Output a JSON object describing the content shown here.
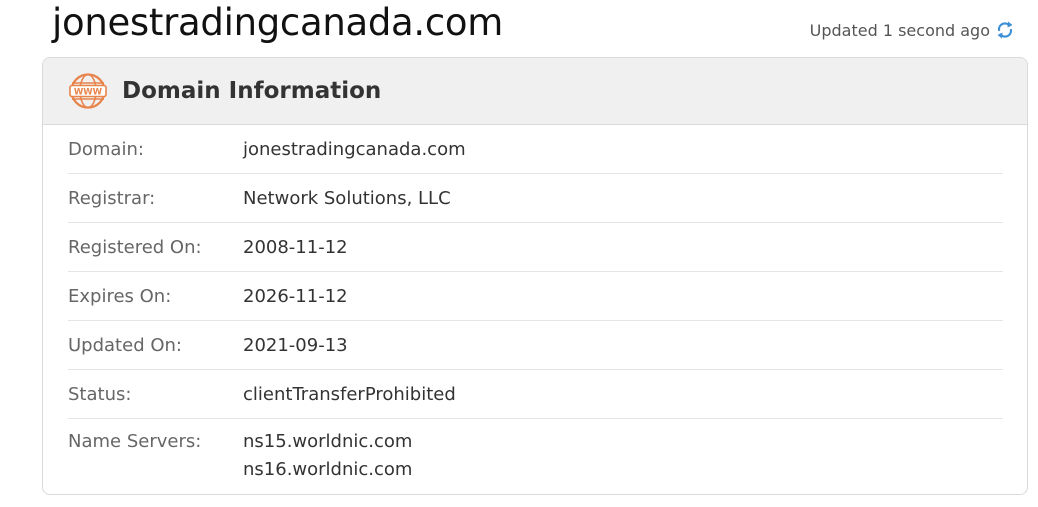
{
  "header": {
    "domain_title": "jonestradingcanada.com",
    "updated_text": "Updated 1 second ago",
    "refresh_icon": "refresh-icon"
  },
  "card": {
    "title": "Domain Information",
    "icon": "www-icon",
    "rows": [
      {
        "label": "Domain:",
        "value": "jonestradingcanada.com"
      },
      {
        "label": "Registrar:",
        "value": "Network Solutions, LLC"
      },
      {
        "label": "Registered On:",
        "value": "2008-11-12"
      },
      {
        "label": "Expires On:",
        "value": "2026-11-12"
      },
      {
        "label": "Updated On:",
        "value": "2021-09-13"
      },
      {
        "label": "Status:",
        "value": "clientTransferProhibited"
      }
    ],
    "name_servers": {
      "label": "Name Servers:",
      "values": [
        "ns15.worldnic.com",
        "ns16.worldnic.com"
      ]
    }
  },
  "colors": {
    "accent_orange": "#e8834a",
    "refresh_blue": "#3d8fd6",
    "header_bg": "#f0f0f0"
  }
}
